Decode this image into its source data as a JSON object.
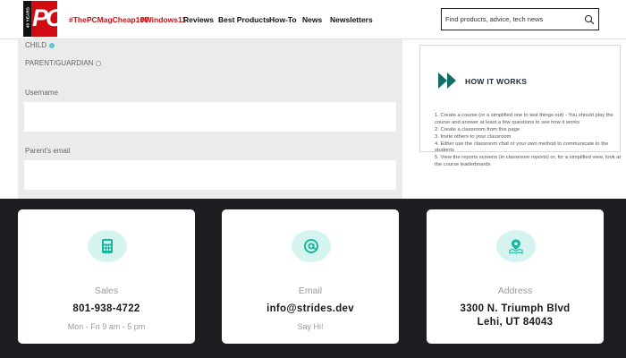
{
  "colors": {
    "brand_red": "#d20a11",
    "accent_teal": "#1ab7a0",
    "icon_bg": "#d6f4ef",
    "dark_section": "#1c1e22"
  },
  "navbar": {
    "logo_text": "PC",
    "logo_badge": "40 YEARS",
    "links": [
      "#ThePCMagCheap100",
      "#Windows11",
      "Reviews",
      "Best Products",
      "How-To",
      "News",
      "Newsletters"
    ],
    "search": {
      "placeholder": "Find products, advice, tech news",
      "icon": "search-icon"
    }
  },
  "form": {
    "radio_child": "CHILD",
    "radio_parent": "PARENT/GUARDIAN",
    "username_label": "Username",
    "parent_email_label": "Parent's email"
  },
  "how_it_works": {
    "icon": "double-chevron-right-icon",
    "title": "HOW IT WORKS",
    "steps": [
      "1. Create a course (or a simplified one to test things out) - You should play the course and answer at least a few questions to see how it works",
      "2. Create a classroom from this page",
      "3. Invite others to your classroom",
      "4. Either use the classroom chat or your own method to communicate to the students",
      "5. View the reports screens (in classroom reports) or, for a simplified view, look at the course leaderboards"
    ]
  },
  "contact": {
    "cards": [
      {
        "icon": "calculator-icon",
        "label": "Sales",
        "value": "801-938-4722",
        "sub": "Mon - Fri 9 am - 5 pm"
      },
      {
        "icon": "at-sign-icon",
        "label": "Email",
        "value": "info@strides.dev",
        "sub": "Say Hi!"
      },
      {
        "icon": "map-pin-icon",
        "label": "Address",
        "value_line1": "3300 N. Triumph Blvd",
        "value_line2": "Lehi, UT 84043"
      }
    ]
  }
}
